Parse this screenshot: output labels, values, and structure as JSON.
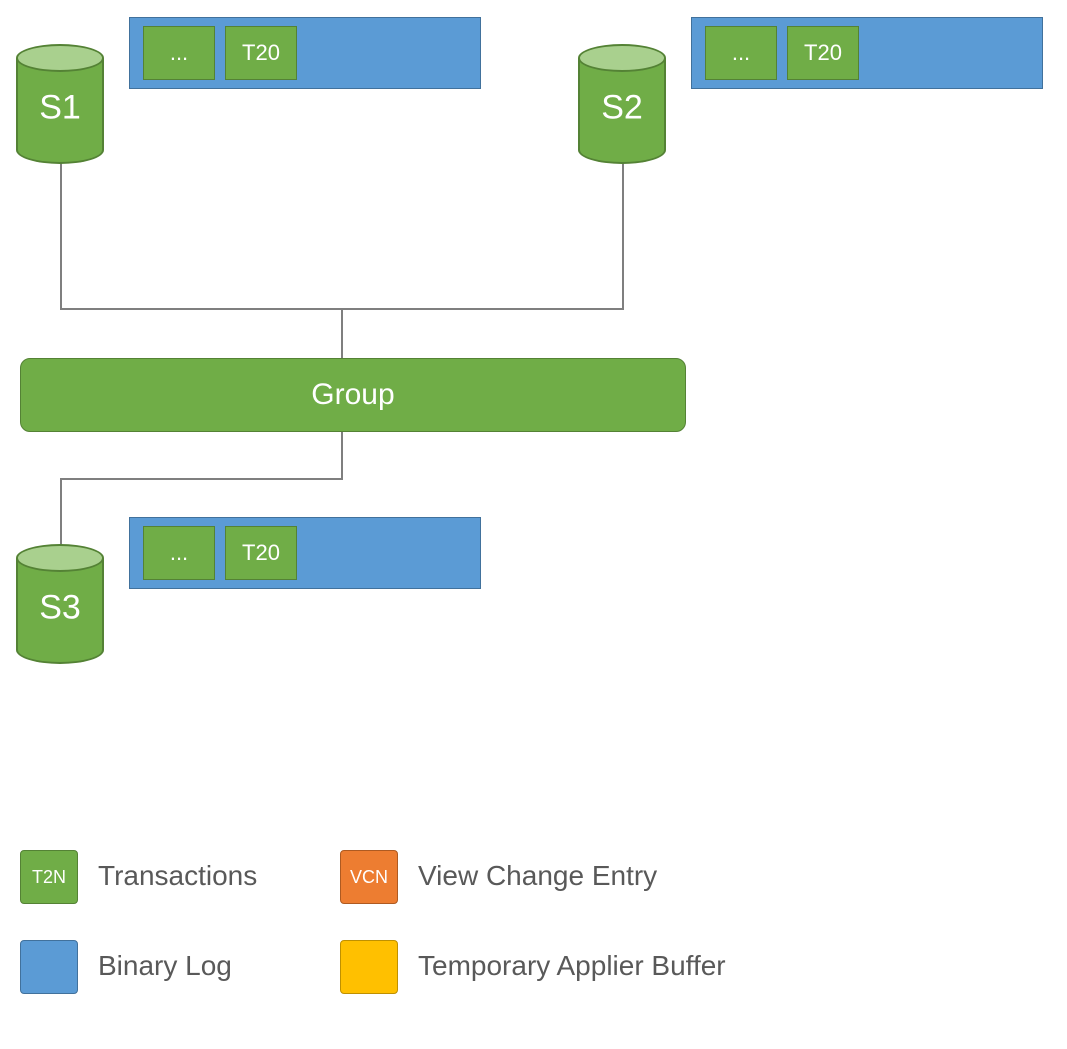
{
  "servers": {
    "s1": {
      "label": "S1",
      "tx1": "...",
      "tx2": "T20"
    },
    "s2": {
      "label": "S2",
      "tx1": "...",
      "tx2": "T20"
    },
    "s3": {
      "label": "S3",
      "tx1": "...",
      "tx2": "T20"
    }
  },
  "group": {
    "label": "Group"
  },
  "legend": {
    "t2n": {
      "code": "T2N",
      "label": "Transactions"
    },
    "vcn": {
      "code": "VCN",
      "label": "View Change Entry"
    },
    "blog": {
      "label": "Binary Log"
    },
    "buf": {
      "label": "Temporary Applier Buffer"
    }
  },
  "colors": {
    "green": "#70AD47",
    "blue": "#5B9BD5",
    "orange": "#ED7D31",
    "yellow": "#FFC000"
  }
}
